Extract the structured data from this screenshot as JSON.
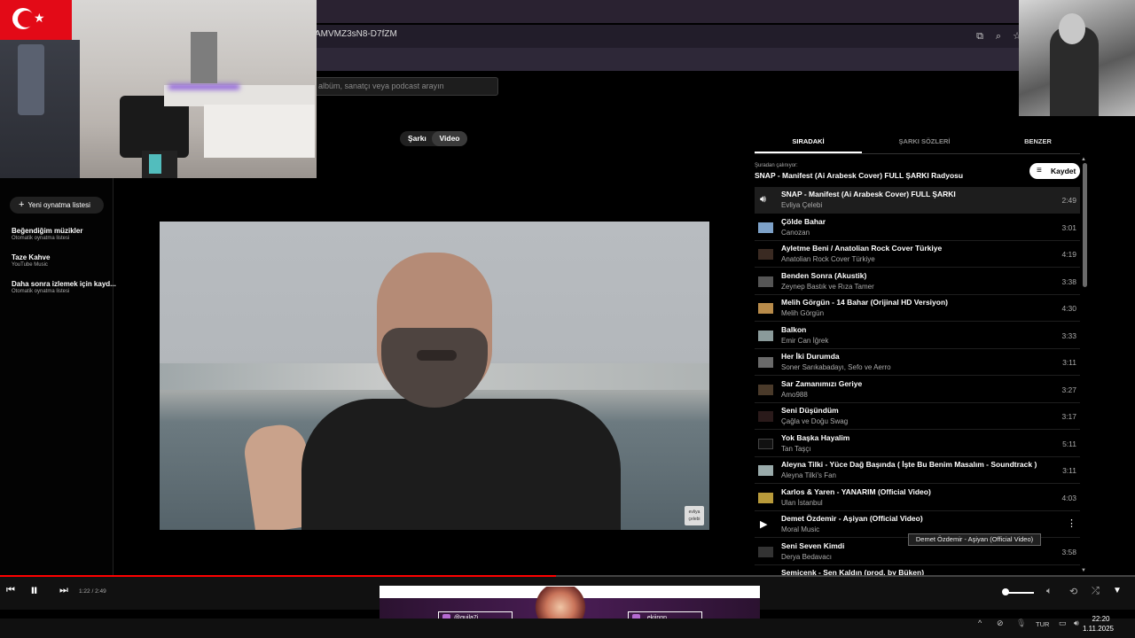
{
  "browser": {
    "url_partial": "AMVMZ3sN8-D7fZM"
  },
  "search": {
    "placeholder": "albüm, sanatçı veya podcast arayın"
  },
  "sidebar": {
    "new_playlist": "Yeni oynatma listesi",
    "items": [
      {
        "title": "Beğendiğim müzikler",
        "subtitle": "Otomatik oynatma listesi"
      },
      {
        "title": "Taze Kahve",
        "subtitle": "YouTube Music"
      },
      {
        "title": "Daha sonra izlemek için kayd...",
        "subtitle": "Otomatik oynatma listesi"
      }
    ]
  },
  "toggle": {
    "song": "Şarkı",
    "video": "Video"
  },
  "video": {
    "watermark": "evliya çelebi"
  },
  "queue": {
    "tabs": [
      "SIRADAKİ",
      "ŞARKI SÖZLERİ",
      "BENZER"
    ],
    "playing_from_label": "Şuradan çalınıyor:",
    "playing_from_title": "SNAP - Manifest (Ai Arabesk Cover) FULL ŞARKI Radyosu",
    "save_label": "Kaydet",
    "items": [
      {
        "title": "SNAP - Manifest (Ai Arabesk Cover) FULL ŞARKI",
        "artist": "Evliya Çelebi",
        "duration": "2:49"
      },
      {
        "title": "Çölde Bahar",
        "artist": "Canozan",
        "duration": "3:01"
      },
      {
        "title": "Ayletme Beni / Anatolian Rock Cover Türkiye",
        "artist": "Anatolian Rock Cover Türkiye",
        "duration": "4:19"
      },
      {
        "title": "Benden Sonra (Akustik)",
        "artist": "Zeynep Bastık ve Rıza Tamer",
        "duration": "3:38"
      },
      {
        "title": "Melih Görgün - 14 Bahar (Orijinal HD Versiyon)",
        "artist": "Melih Görgün",
        "duration": "4:30"
      },
      {
        "title": "Balkon",
        "artist": "Emir Can İğrek",
        "duration": "3:33"
      },
      {
        "title": "Her İki Durumda",
        "artist": "Soner Sarıkabadayı, Sefo ve Aerro",
        "duration": "3:11"
      },
      {
        "title": "Sar Zamanımızı Geriye",
        "artist": "Amo988",
        "duration": "3:27"
      },
      {
        "title": "Seni Düşündüm",
        "artist": "Çağla ve Doğu Swag",
        "duration": "3:17"
      },
      {
        "title": "Yok Başka Hayalim",
        "artist": "Tan Taşçı",
        "duration": "5:11"
      },
      {
        "title": "Aleyna Tilki - Yüce Dağ Başında ( İşte Bu Benim Masalım - Soundtrack )",
        "artist": "Aleyna Tilki's Fan",
        "duration": "3:11"
      },
      {
        "title": "Karlos & Yaren - YANARIM (Official Video)",
        "artist": "Ulan İstanbul",
        "duration": "4:03"
      },
      {
        "title": "Demet Özdemir - Aşiyan (Official Video)",
        "artist": "Moral Music",
        "duration": ""
      },
      {
        "title": "Seni Seven Kimdi",
        "artist": "Derya Bedavacı",
        "duration": "3:58"
      },
      {
        "title": "Semicenk - Sen Kaldın (prod. by Büken)",
        "artist": "",
        "duration": ""
      }
    ],
    "tooltip": "Demet Özdemir - Aşiyan (Official Video)"
  },
  "player": {
    "time": "1:22 / 2:49",
    "progress_fraction": 0.49
  },
  "stream": {
    "social_left": "@quila7i",
    "social_right": "_ekiinnn"
  },
  "taskbar": {
    "lang": "TUR",
    "time": "22:20",
    "date": "1.11.2025"
  }
}
